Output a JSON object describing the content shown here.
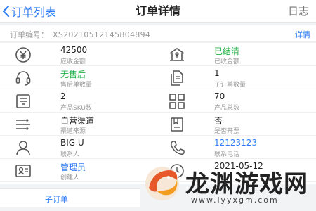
{
  "header": {
    "back_label": "订单列表",
    "title": "订单详情",
    "log_label": "日志"
  },
  "order": {
    "number_label": "订单编号：",
    "number": "XS20210512145804894",
    "detail_label": "详情"
  },
  "rows": [
    {
      "left": {
        "icon": "yen-icon",
        "value": "42500",
        "label": "应收金额"
      },
      "right": {
        "icon": "bank-icon",
        "value": "已结清",
        "label": "已收金额",
        "value_color": "#24b24a"
      }
    },
    {
      "left": {
        "icon": "headset-icon",
        "value": "无售后",
        "label": "售后单数量",
        "value_color": "#24b24a"
      },
      "right": {
        "icon": "documents-icon",
        "value": "1",
        "label": "子订单数量"
      }
    },
    {
      "left": {
        "icon": "product-box-icon",
        "value": "2",
        "label": "产品SKU数"
      },
      "right": {
        "icon": "grid-icon",
        "value": "70",
        "label": "产品总数"
      }
    },
    {
      "left": {
        "icon": "channel-lines-icon",
        "value": "自营渠道",
        "label": "渠道来源"
      },
      "right": {
        "icon": "invoice-icon",
        "value": "否",
        "label": "是否开票"
      }
    },
    {
      "left": {
        "icon": "person-icon",
        "value": "BIG U",
        "label": "联系人"
      },
      "right": {
        "icon": "phone-icon",
        "value": "12123123",
        "label": "联系电话",
        "value_color": "#2f7cf6"
      }
    },
    {
      "left": {
        "icon": "id-card-icon",
        "value": "管理员",
        "label": "创建人",
        "value_color": "#2f7cf6"
      },
      "right": {
        "icon": "clock-icon",
        "value": "2021-05-12",
        "label": ""
      }
    }
  ],
  "suborder_tab": "子订单",
  "watermark": {
    "text": "龙渊游戏网",
    "url": "www.lyyxgm.com"
  }
}
